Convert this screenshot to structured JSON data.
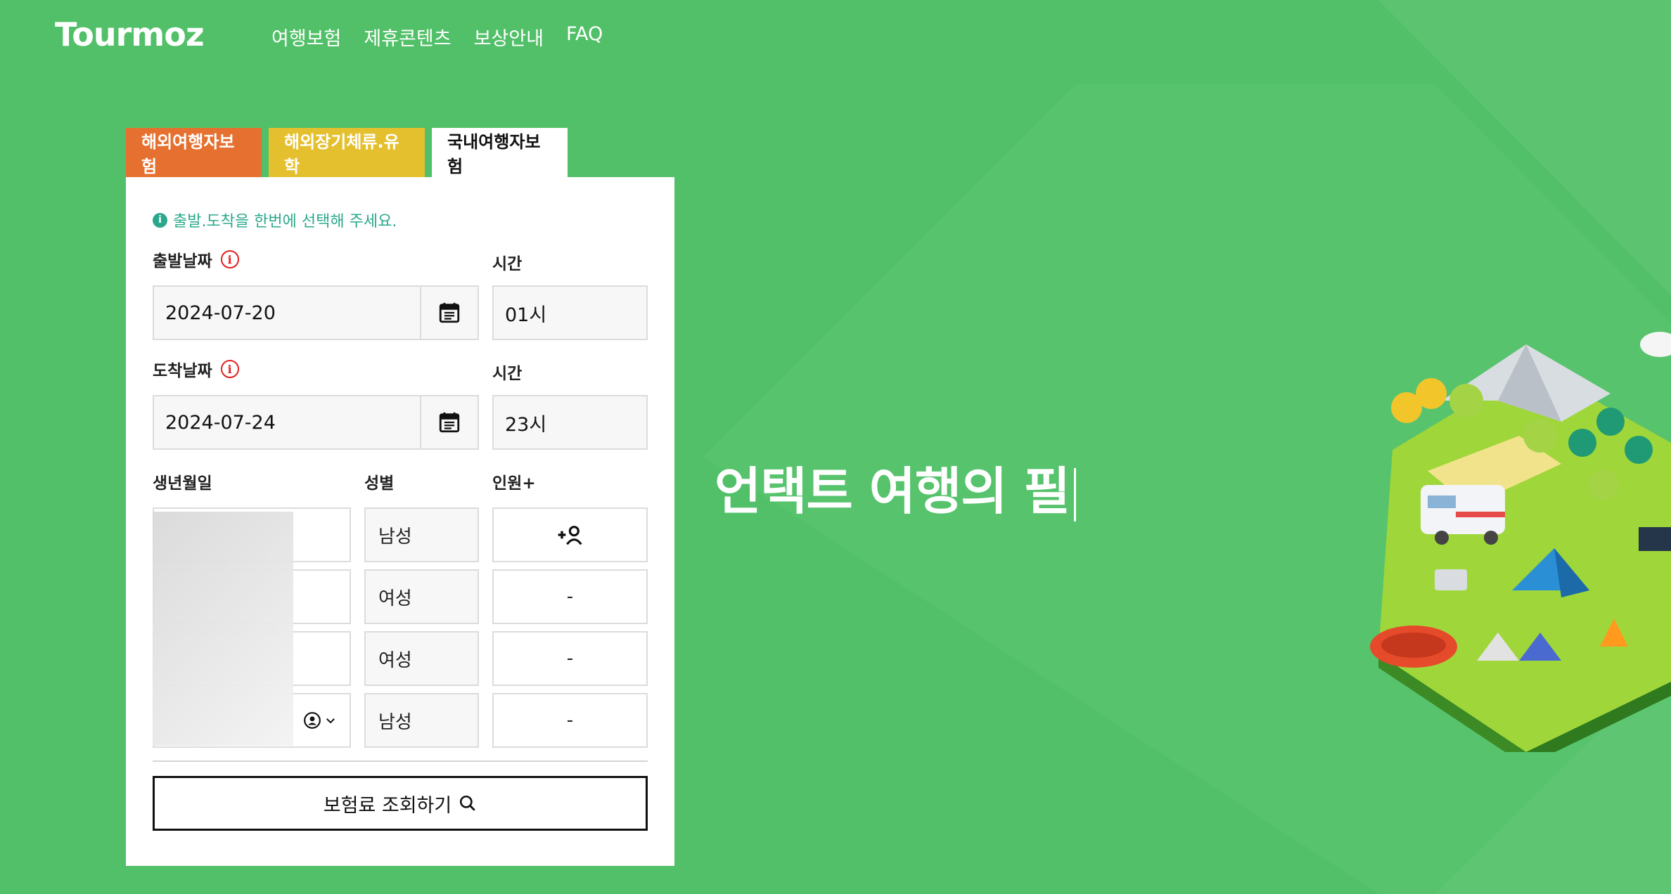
{
  "brand": {
    "logo_text": "Tourmoz"
  },
  "nav": {
    "items": [
      "여행보험",
      "제휴콘텐츠",
      "보상안내",
      "FAQ"
    ]
  },
  "tabs": [
    "해외여행자보험",
    "해외장기체류.유학",
    "국내여행자보험"
  ],
  "form": {
    "notice": "출발.도착을 한번에 선택해 주세요.",
    "departure": {
      "label": "출발날짜",
      "value": "2024-07-20",
      "time_label": "시간",
      "time_value": "01시"
    },
    "arrival": {
      "label": "도착날짜",
      "value": "2024-07-24",
      "time_label": "시간",
      "time_value": "23시"
    },
    "travelers": {
      "birth_label": "생년월일",
      "gender_label": "성별",
      "count_label": "인원+",
      "rows": [
        {
          "gender": "남성",
          "action": ""
        },
        {
          "gender": "여성",
          "action": "-"
        },
        {
          "gender": "여성",
          "action": "-"
        },
        {
          "gender": "남성",
          "action": "-"
        }
      ]
    },
    "search_label": "보험료 조회하기"
  },
  "headline": "언택트 여행의 필",
  "colors": {
    "bg": "#52c068",
    "tab_overseas": "#e5702f",
    "tab_long": "#e5c02e",
    "notice": "#2ba88c",
    "warn": "#e02020"
  }
}
